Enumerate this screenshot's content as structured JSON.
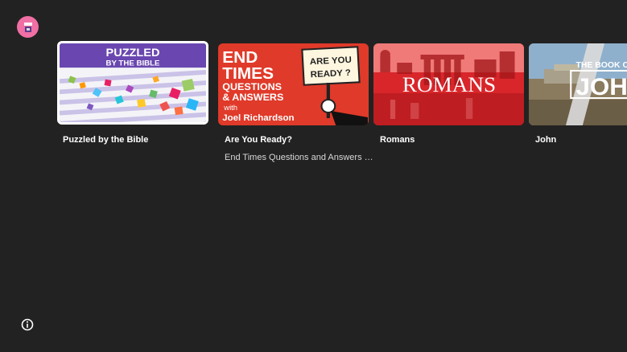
{
  "profile": {
    "avatar_icon": "profile-avatar-icon"
  },
  "row": {
    "cards": [
      {
        "title": "Puzzled by the Bible",
        "subtitle": "",
        "art": {
          "line1": "PUZZLED",
          "line2": "BY THE BIBLE"
        }
      },
      {
        "title": "Are You Ready?",
        "subtitle": "End Times Questions and Answers with Joel Richardson",
        "art": {
          "line1": "END",
          "line2": "TIMES",
          "line3": "QUESTIONS",
          "line4": "& ANSWERS",
          "line5": "with",
          "line6": "Joel Richardson",
          "sign1": "ARE YOU",
          "sign2": "READY ?"
        }
      },
      {
        "title": "Romans",
        "subtitle": "",
        "art": {
          "line1": "ROMANS"
        }
      },
      {
        "title": "John",
        "subtitle": "",
        "art": {
          "line1": "THE BOOK OF",
          "line2": "JOHN"
        }
      }
    ]
  },
  "info": {
    "icon": "info-icon"
  },
  "colors": {
    "background": "#222222",
    "avatar_bg": "#f06fa4",
    "puzzle_purple": "#6a47b0",
    "end_times_red": "#e03a2a",
    "romans_red": "#d8262b"
  }
}
